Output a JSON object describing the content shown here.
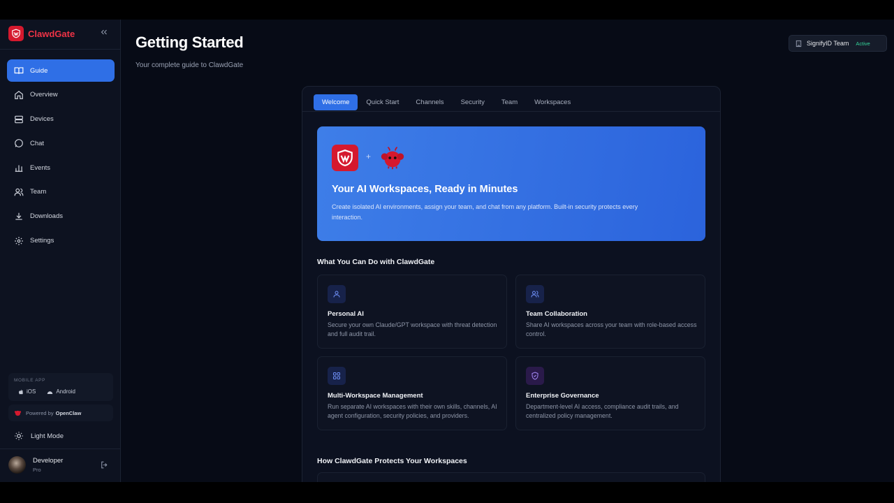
{
  "app": {
    "brand": "ClawdGate"
  },
  "sidebar": {
    "items": [
      {
        "label": "Guide",
        "icon": "book-icon",
        "active": true
      },
      {
        "label": "Overview",
        "icon": "home-icon"
      },
      {
        "label": "Devices",
        "icon": "server-icon"
      },
      {
        "label": "Chat",
        "icon": "chat-icon"
      },
      {
        "label": "Events",
        "icon": "bar-chart-icon"
      },
      {
        "label": "Team",
        "icon": "users-icon"
      },
      {
        "label": "Downloads",
        "icon": "download-icon"
      },
      {
        "label": "Settings",
        "icon": "gear-icon"
      }
    ],
    "mobile_app": {
      "title": "MOBILE APP",
      "ios": "iOS",
      "android": "Android"
    },
    "powered_by": {
      "prefix": "Powered by",
      "name": "OpenClaw"
    },
    "theme_toggle": "Light Mode",
    "user": {
      "name": "Developer",
      "plan": "Pro"
    }
  },
  "header": {
    "title": "Getting Started",
    "subtitle": "Your complete guide to ClawdGate",
    "team": {
      "name": "SignifyID Team",
      "status": "Active"
    }
  },
  "tabs": [
    "Welcome",
    "Quick Start",
    "Channels",
    "Security",
    "Team",
    "Workspaces"
  ],
  "hero": {
    "plus": "+",
    "title": "Your AI Workspaces, Ready in Minutes",
    "description": "Create isolated AI environments, assign your team, and chat from any platform. Built-in security protects every interaction."
  },
  "features_section": {
    "title": "What You Can Do with ClawdGate",
    "items": [
      {
        "title": "Personal AI",
        "description": "Secure your own Claude/GPT workspace with threat detection and full audit trail.",
        "icon": "user-icon",
        "color": "#6f8ff7"
      },
      {
        "title": "Team Collaboration",
        "description": "Share AI workspaces across your team with role-based access control.",
        "icon": "users-icon",
        "color": "#6f8ff7"
      },
      {
        "title": "Multi-Workspace Management",
        "description": "Run separate AI workspaces with their own skills, channels, AI agent configuration, security policies, and providers.",
        "icon": "grid-icon",
        "color": "#6f8ff7"
      },
      {
        "title": "Enterprise Governance",
        "description": "Department-level AI access, compliance audit trails, and centralized policy management.",
        "icon": "shield-icon",
        "color": "#a78bfa"
      }
    ]
  },
  "protects_section": {
    "title": "How ClawdGate Protects Your Workspaces"
  }
}
